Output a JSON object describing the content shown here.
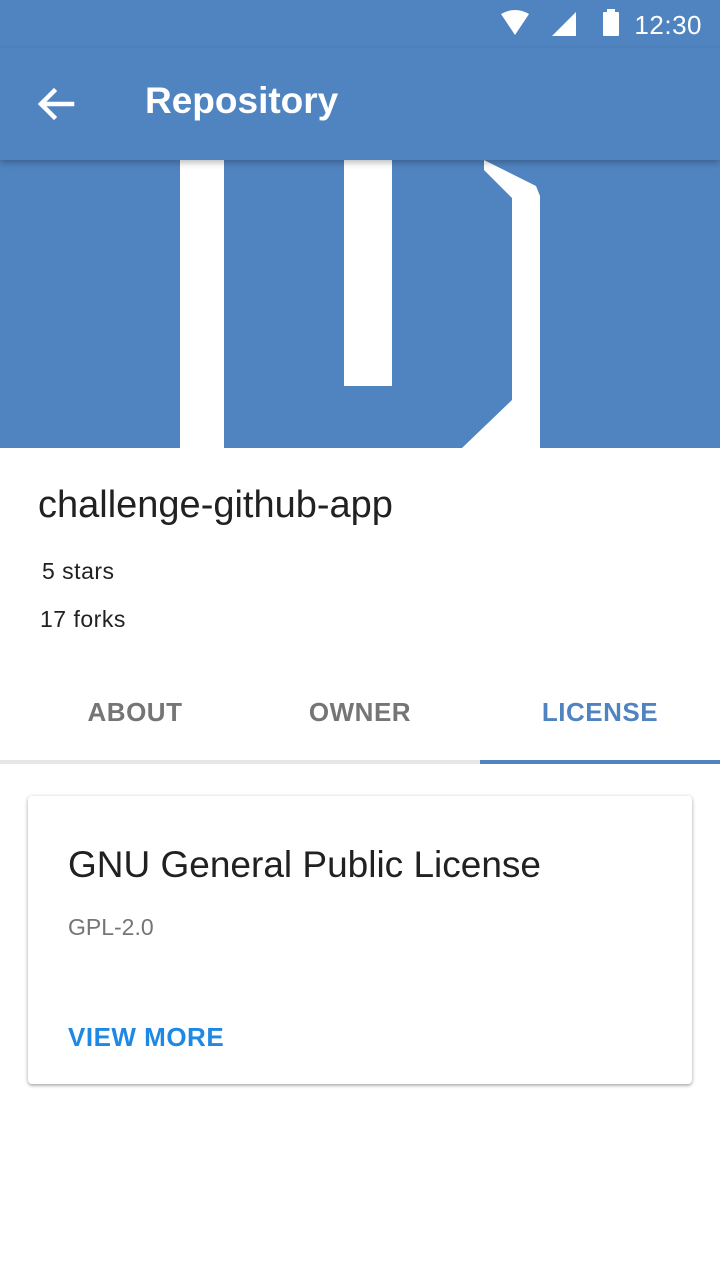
{
  "status_bar": {
    "time": "12:30",
    "icons": [
      "wifi-icon",
      "signal-icon",
      "battery-icon"
    ]
  },
  "app_bar": {
    "title": "Repository",
    "back_icon": "arrow-back-icon"
  },
  "hero": {
    "image": "repository-owner-avatar"
  },
  "repository": {
    "name": "challenge-github-app",
    "stars": "5 stars",
    "forks": "17 forks"
  },
  "tabs": [
    {
      "label": "ABOUT",
      "active": false
    },
    {
      "label": "OWNER",
      "active": false
    },
    {
      "label": "LICENSE",
      "active": true
    }
  ],
  "license_card": {
    "name": "GNU General Public License",
    "key": "GPL-2.0",
    "action_label": "VIEW MORE"
  },
  "colors": {
    "primary": "#5084c1",
    "accent": "#1e88e5",
    "text_primary": "#212121",
    "text_secondary": "#757575"
  }
}
